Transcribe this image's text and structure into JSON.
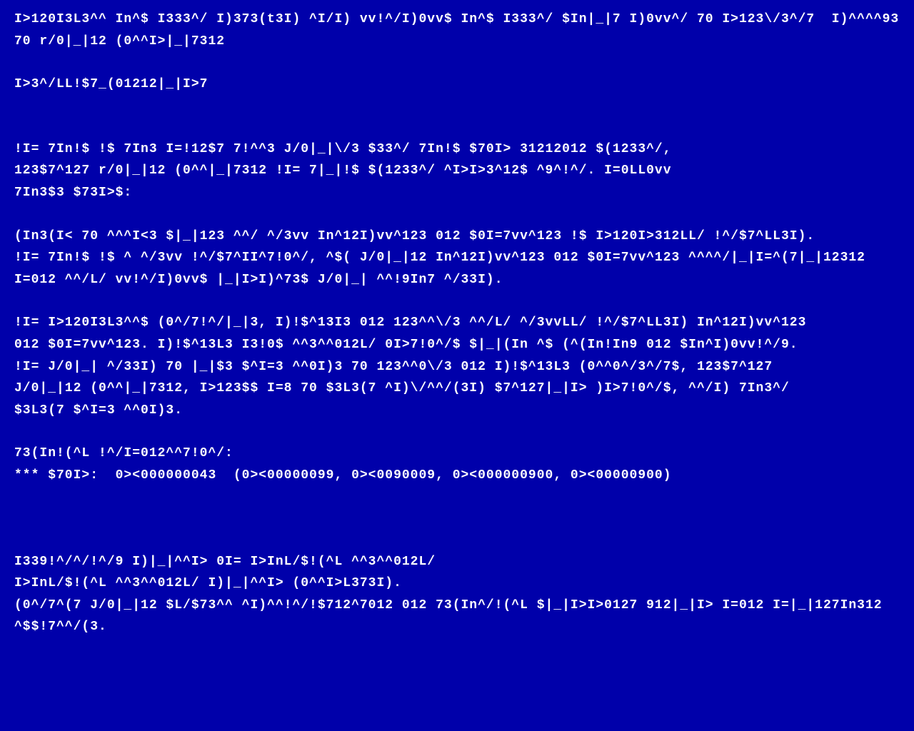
{
  "lines": [
    "I>120I3L3^^ In^$ I333^/ I)373(t3I) ^I/I) vv!^/I)0vv$ In^$ I333^/ $In|_|7 I)0vv^/ 70 I>123\\/3^/7  I)^^^^93",
    "70 r/0|_|12 (0^^I>|_|7312",
    "",
    "I>3^/LL!$7_(01212|_|I>7",
    "",
    "",
    "!I= 7In!$ !$ 7In3 I=!12$7 7!^^3 J/0|_|\\/3 $33^/ 7In!$ $70I> 31212012 $(1233^/,",
    "123$7^127 r/0|_|12 (0^^|_|7312 !I= 7|_|!$ $(1233^/ ^I>I>3^12$ ^9^!^/. I=0LL0vv",
    "7In3$3 $73I>$:",
    "",
    "(In3(I< 70 ^^^I<3 $|_|123 ^^/ ^/3vv In^12I)vv^123 012 $0I=7vv^123 !$ I>120I>312LL/ !^/$7^LL3I).",
    "!I= 7In!$ !$ ^ ^/3vv !^/$7^II^7!0^/, ^$( J/0|_|12 In^12I)vv^123 012 $0I=7vv^123 ^^^^/|_|I=^(7|_|12312",
    "I=012 ^^/L/ vv!^/I)0vv$ |_|I>I)^73$ J/0|_| ^^!9In7 ^/33I).",
    "",
    "!I= I>120I3L3^^$ (0^/7!^/|_|3, I)!$^13I3 012 123^^\\/3 ^^/L/ ^/3vvLL/ !^/$7^LL3I) In^12I)vv^123",
    "012 $0I=7vv^123. I)!$^13L3 I3!0$ ^^3^^012L/ 0I>7!0^/$ $|_|(In ^$ (^(In!In9 012 $In^I)0vv!^/9.",
    "!I= J/0|_| ^/33I) 70 |_|$3 $^I=3 ^^0I)3 70 123^^0\\/3 012 I)!$^13L3 (0^^0^/3^/7$, 123$7^127",
    "J/0|_|12 (0^^|_|7312, I>123$$ I=8 70 $3L3(7 ^I)\\/^^/(3I) $7^127|_|I> )I>7!0^/$, ^^/I) 7In3^/",
    "$3L3(7 $^I=3 ^^0I)3.",
    "",
    "73(In!(^L !^/I=012^^7!0^/:",
    "*** $70I>:  0><000000043  (0><00000099, 0><0090009, 0><000000900, 0><00000900)",
    "",
    "",
    "",
    "I339!^/^/!^/9 I)|_|^^I> 0I= I>InL/$!(^L ^^3^^012L/",
    "I>InL/$!(^L ^^3^^012L/ I)|_|^^I> (0^^I>L373I).",
    "(0^/7^(7 J/0|_|12 $L/$73^^ ^I)^^!^/!$712^7012 012 73(In^/!(^L $|_|I>I>0127 912|_|I> I=012 I=|_|127In312",
    "^$$!7^^/(3."
  ]
}
